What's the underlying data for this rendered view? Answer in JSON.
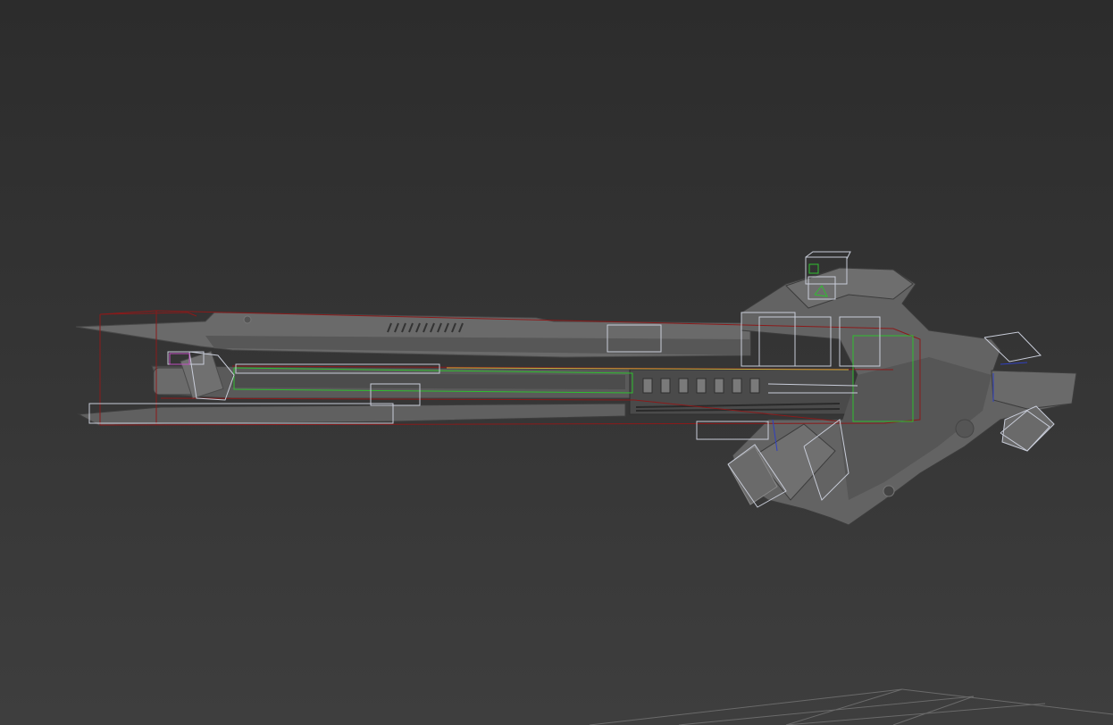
{
  "viewport": {
    "background_top": "#2c2c2c",
    "background_bottom": "#3e3e3e",
    "view_mode": "perspective-shaded"
  },
  "scene": {
    "object": "sci-fi-rifle-mesh",
    "mesh_color": "#5f5f5f",
    "mesh_dark": "#3a3a3a",
    "mesh_light": "#7a7a7a",
    "selection_colors": {
      "bounding_box": "#8b1a1a",
      "selected_helper": "#2fbf2f",
      "helper_outline": "#c8ccd8",
      "accent_magenta": "#c050c0",
      "accent_blue": "#3040c0",
      "accent_yellow": "#c8b040"
    },
    "grid": {
      "visible": true,
      "color": "#6a6a6a"
    }
  }
}
